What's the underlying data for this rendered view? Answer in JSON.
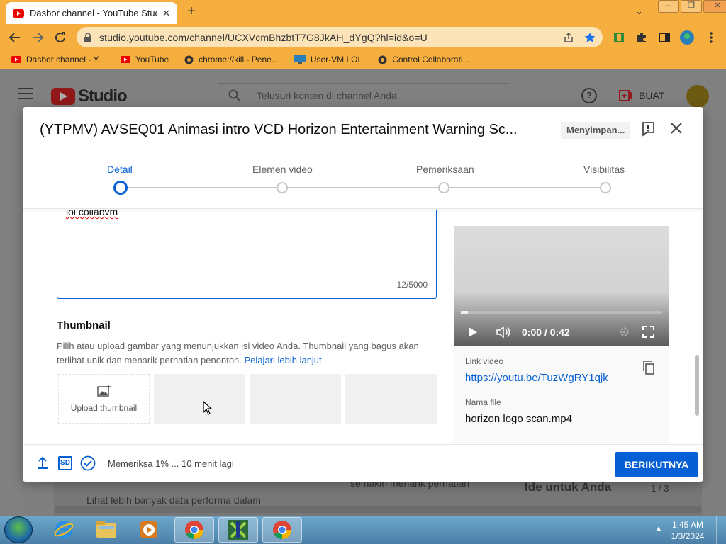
{
  "browser": {
    "tab_title": "Dasbor channel - YouTube Studio",
    "new_tab": "+",
    "url": "studio.youtube.com/channel/UCXVcmBhzbtT7G8JkAH_dYgQ?hl=id&o=U",
    "bookmarks": [
      {
        "label": "Dasbor channel - Y...",
        "icon": "youtube-icon"
      },
      {
        "label": "YouTube",
        "icon": "youtube-icon"
      },
      {
        "label": "chrome://kill - Pene...",
        "icon": "globe-icon"
      },
      {
        "label": "User-VM LOL",
        "icon": "monitor-icon"
      },
      {
        "label": "Control Collaborati...",
        "icon": "globe-icon"
      }
    ],
    "accent": "#f6ae3e"
  },
  "studio": {
    "logo_text": "Studio",
    "search_placeholder": "Telusuri konten di channel Anda",
    "help": "?",
    "create_label": "BUAT",
    "bg_text_1": "Lihat lebih banyak data performa dalam",
    "bg_text_2": "semakin menarik perhatian",
    "bg_text_3": "Ide untuk Anda",
    "bg_text_4": "1 / 3"
  },
  "dialog": {
    "title": "(YTPMV) AVSEQ01 Animasi intro VCD Horizon Entertainment Warning Sc...",
    "saving": "Menyimpan...",
    "steps": [
      "Detail",
      "Elemen video",
      "Pemeriksaan",
      "Visibilitas"
    ],
    "active_step": 0,
    "description_value": "lol collabvm",
    "char_count": "12/5000",
    "thumbnail_title": "Thumbnail",
    "thumbnail_desc": "Pilih atau upload gambar yang menunjukkan isi video Anda. Thumbnail yang bagus akan terlihat unik dan menarik perhatian penonton.",
    "thumbnail_learn_more": "Pelajari lebih lanjut",
    "upload_thumbnail": "Upload thumbnail",
    "video_time": "0:00 / 0:42",
    "link_label": "Link video",
    "link_value": "https://youtu.be/TuzWgRY1qjk",
    "filename_label": "Nama file",
    "filename_value": "horizon logo scan.mp4",
    "footer_status": "Memeriksa 1% ... 10 menit lagi",
    "sd_badge": "SD",
    "next_button": "BERIKUTNYA",
    "accent": "#065fd4"
  },
  "taskbar": {
    "time": "1:45 AM",
    "date": "1/3/2024",
    "tray_arrow": "▲"
  }
}
